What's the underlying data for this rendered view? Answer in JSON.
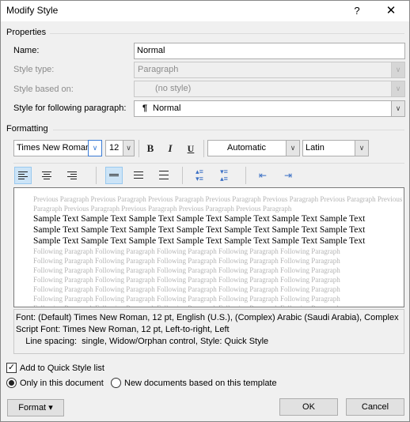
{
  "window": {
    "title": "Modify Style",
    "help_label": "?",
    "close_label": "✕"
  },
  "properties": {
    "section_label": "Properties",
    "name_label": "Name:",
    "name_value": "Normal",
    "style_type_label": "Style type:",
    "style_type_value": "Paragraph",
    "style_based_on_label": "Style based on:",
    "style_based_on_value": "(no style)",
    "following_label": "Style for following paragraph:",
    "following_icon": "¶",
    "following_value": "Normal"
  },
  "formatting": {
    "section_label": "Formatting",
    "font_value": "Times New Roman",
    "size_value": "12",
    "bold_label": "B",
    "italic_label": "I",
    "underline_label": "U",
    "color_value": "Automatic",
    "script_value": "Latin"
  },
  "toolbar": {
    "align_left_icon": "align-left-icon",
    "align_center_icon": "align-center-icon",
    "align_right_icon": "align-right-icon",
    "spacing_single_icon": "line-spacing-single-icon",
    "spacing_onehalf_icon": "line-spacing-1.5-icon",
    "spacing_double_icon": "line-spacing-double-icon",
    "space_before_icon": "increase-paragraph-spacing-icon",
    "space_after_icon": "decrease-paragraph-spacing-icon",
    "decrease_indent_icon": "decrease-indent-icon",
    "increase_indent_icon": "increase-indent-icon",
    "active_alignment": "left",
    "active_spacing": "single"
  },
  "preview": {
    "previous_lines": [
      "Previous Paragraph Previous Paragraph Previous Paragraph Previous Paragraph Previous Paragraph Previous Paragraph Previous",
      "Paragraph Previous Paragraph Previous Paragraph Previous Paragraph Previous Paragraph"
    ],
    "sample_lines": [
      "Sample Text Sample Text Sample Text Sample Text Sample Text Sample Text Sample Text",
      "Sample Text Sample Text Sample Text Sample Text Sample Text Sample Text Sample Text",
      "Sample Text Sample Text Sample Text Sample Text Sample Text Sample Text Sample Text"
    ],
    "following_lines": [
      "Following Paragraph Following Paragraph Following Paragraph Following Paragraph Following Paragraph",
      "Following Paragraph Following Paragraph Following Paragraph Following Paragraph Following Paragraph",
      "Following Paragraph Following Paragraph Following Paragraph Following Paragraph Following Paragraph",
      "Following Paragraph Following Paragraph Following Paragraph Following Paragraph Following Paragraph",
      "Following Paragraph Following Paragraph Following Paragraph Following Paragraph Following Paragraph",
      "Following Paragraph Following Paragraph Following Paragraph Following Paragraph Following Paragraph",
      "Following Paragraph Following Paragraph Following Paragraph Following Paragraph Following Paragraph"
    ]
  },
  "description": {
    "lines": [
      "Font: (Default) Times New Roman, 12 pt, English (U.S.), (Complex) Arabic (Saudi Arabia), Complex",
      "Script Font: Times New Roman, 12 pt, Left-to-right, Left",
      "    Line spacing:  single, Widow/Orphan control, Style: Quick Style"
    ]
  },
  "options": {
    "add_quick_style_label": "Add to Quick Style list",
    "add_quick_style_checked": true,
    "only_doc_label": "Only in this document",
    "new_docs_label": "New documents based on this template",
    "selected_scope": "only_doc"
  },
  "buttons": {
    "format_label": "Format",
    "format_arrow": "▾",
    "ok_label": "OK",
    "cancel_label": "Cancel"
  },
  "colors": {
    "active_button_bg": "#cce4f7",
    "active_button_border": "#99c9ef",
    "focus_blue": "#3a7bd5"
  }
}
